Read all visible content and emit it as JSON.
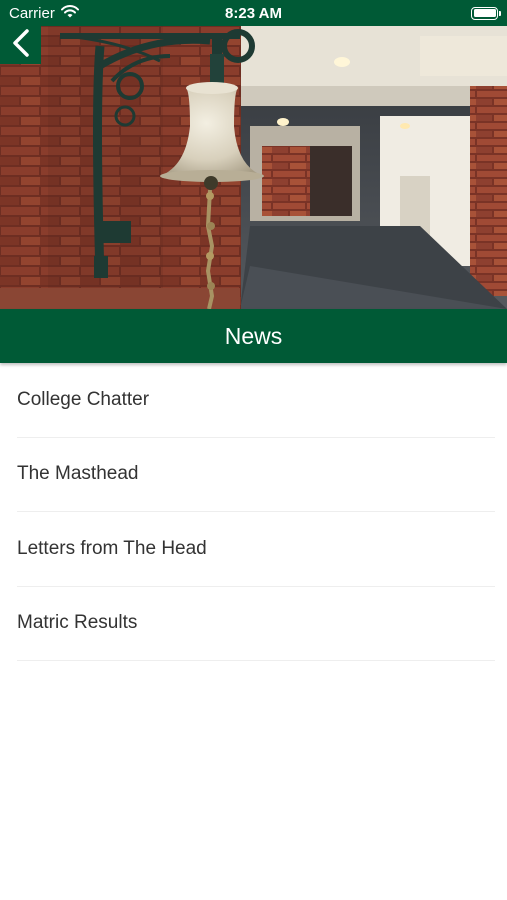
{
  "status_bar": {
    "carrier": "Carrier",
    "time": "8:23 AM",
    "wifi_icon": "wifi-icon",
    "battery_icon": "battery-full-icon"
  },
  "header": {
    "back_icon": "chevron-left-icon",
    "hero_image": "bell-on-brick-wall-photo",
    "title": "News"
  },
  "news_items": [
    {
      "label": "College Chatter"
    },
    {
      "label": "The Masthead"
    },
    {
      "label": "Letters from The Head"
    },
    {
      "label": "Matric Results"
    }
  ],
  "colors": {
    "brand_green": "#005a36",
    "background": "#ffffff",
    "list_text": "#333333",
    "divider": "#eeeeee"
  }
}
